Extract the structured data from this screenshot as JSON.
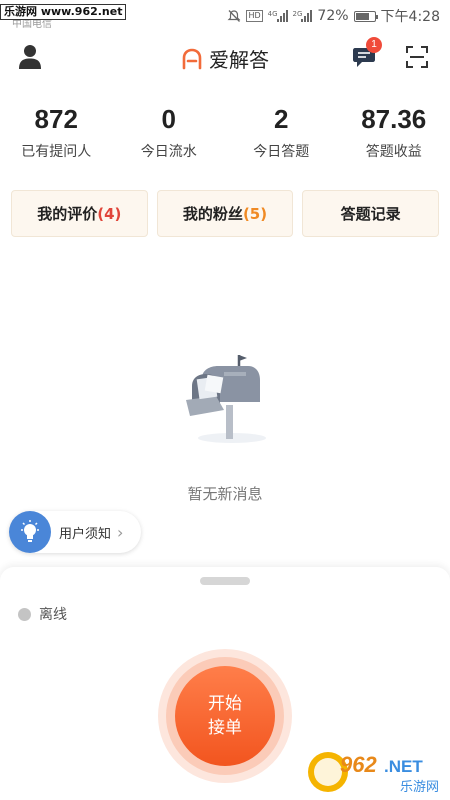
{
  "status_bar": {
    "carrier": "中国电信",
    "watermark": "乐游网 www.962.net",
    "hd_badge": "HD",
    "net_4g": "4G",
    "net_2g": "2G",
    "battery_percent": "72%",
    "battery_level": 0.72,
    "time": "下午4:28"
  },
  "header": {
    "app_name": "爱解答",
    "message_badge": "1",
    "brand_color": "#f26b3a"
  },
  "stats": [
    {
      "value": "872",
      "label": "已有提问人"
    },
    {
      "value": "0",
      "label": "今日流水"
    },
    {
      "value": "2",
      "label": "今日答题"
    },
    {
      "value": "87.36",
      "label": "答题收益"
    }
  ],
  "actions": {
    "reviews_label": "我的评价",
    "reviews_count": "(4)",
    "fans_label": "我的粉丝",
    "fans_count": "(5)",
    "records_label": "答题记录"
  },
  "empty_state": {
    "message": "暂无新消息"
  },
  "notice": {
    "label": "用户须知"
  },
  "bottom_sheet": {
    "status_label": "离线",
    "start_line1": "开始",
    "start_line2": "接单",
    "start_color": "#f2551f"
  },
  "corner_watermark": {
    "number": "962",
    "suffix": ".NET",
    "name": "乐游网"
  }
}
